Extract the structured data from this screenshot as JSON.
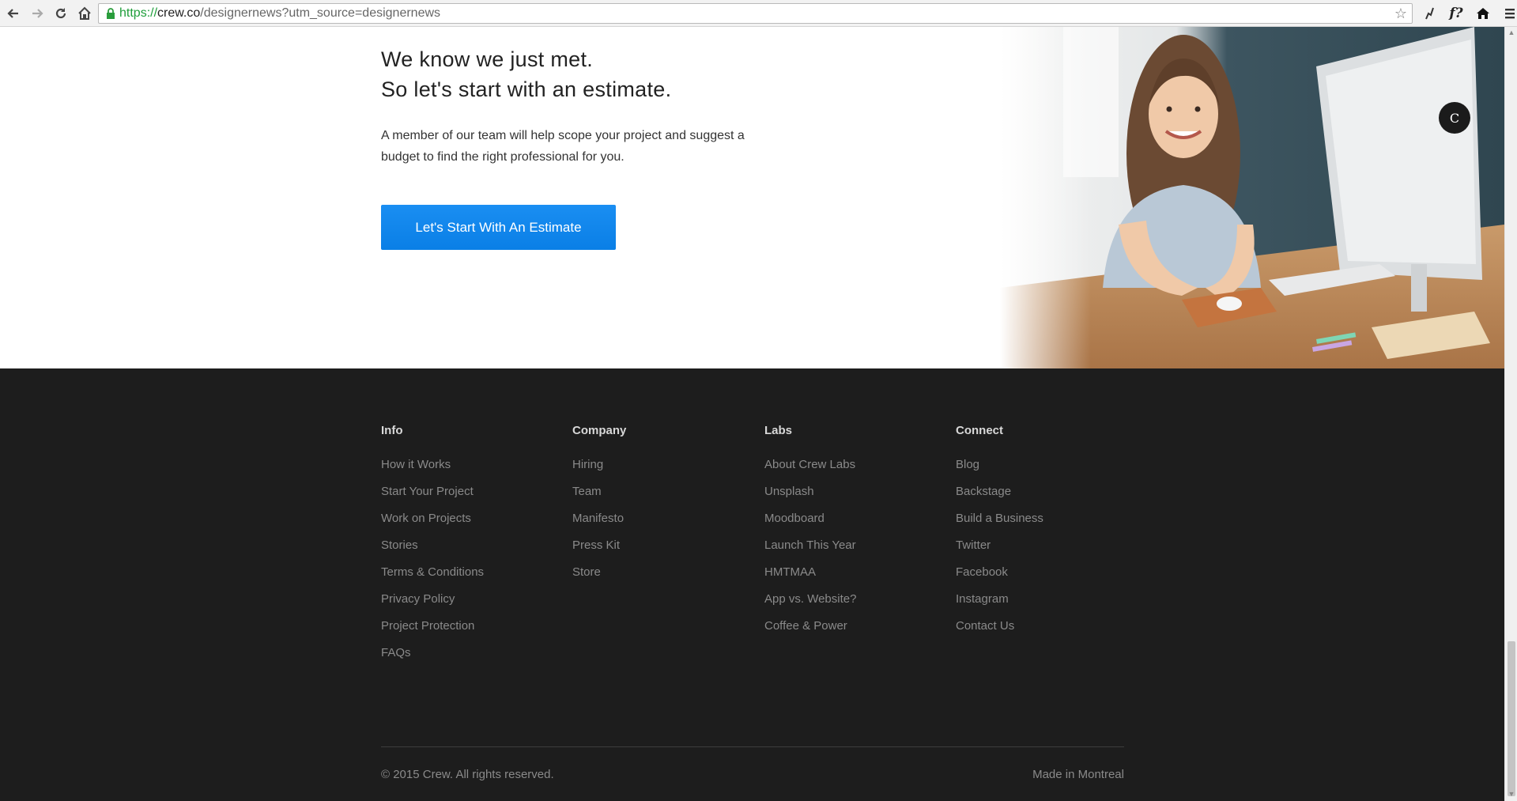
{
  "browser": {
    "url_protocol": "https://",
    "url_host": "crew.co",
    "url_path": "/designernews?utm_source=designernews"
  },
  "hero": {
    "headline_line1": "We know we just met.",
    "headline_line2": "So let's start with an estimate.",
    "subtext": "A member of our team will help scope your project and suggest a budget to find the right professional for you.",
    "cta_label": "Let's Start With An Estimate"
  },
  "footer": {
    "columns": [
      {
        "title": "Info",
        "links": [
          "How it Works",
          "Start Your Project",
          "Work on Projects",
          "Stories",
          "Terms & Conditions",
          "Privacy Policy",
          "Project Protection",
          "FAQs"
        ]
      },
      {
        "title": "Company",
        "links": [
          "Hiring",
          "Team",
          "Manifesto",
          "Press Kit",
          "Store"
        ]
      },
      {
        "title": "Labs",
        "links": [
          "About Crew Labs",
          "Unsplash",
          "Moodboard",
          "Launch This Year",
          "HMTMAA",
          "App vs. Website?",
          "Coffee & Power"
        ]
      },
      {
        "title": "Connect",
        "links": [
          "Blog",
          "Backstage",
          "Build a Business",
          "Twitter",
          "Facebook",
          "Instagram",
          "Contact Us"
        ]
      }
    ],
    "copyright": "© 2015 Crew. All rights reserved.",
    "made_in": "Made in Montreal"
  },
  "colors": {
    "accent": "#0a84ec",
    "footer_bg": "#1d1d1d",
    "secure_green": "#1e9e3a"
  }
}
